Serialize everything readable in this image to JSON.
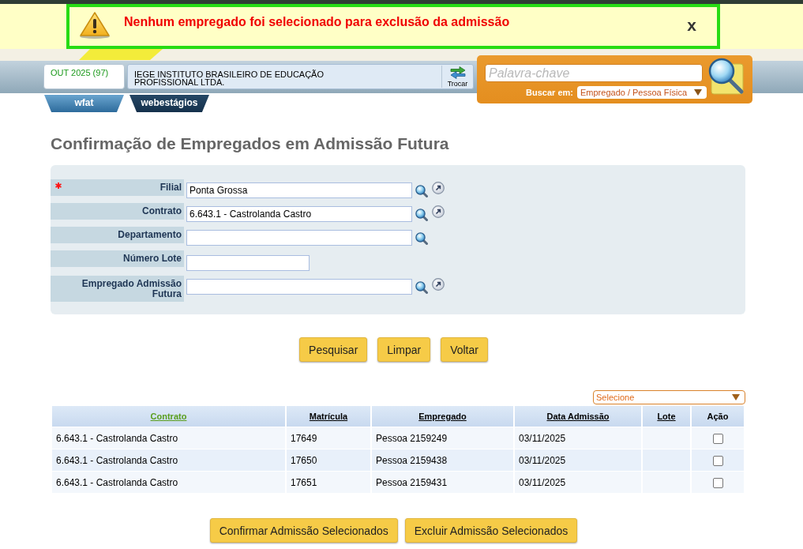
{
  "alert": {
    "message": "Nenhum empregado foi selecionado para exclusão da admissão",
    "close": "x"
  },
  "header": {
    "period": "OUT 2025 (97)",
    "company": "IEGE INSTITUTO BRASILEIRO DE EDUCAÇÃO PROFISSIONAL LTDA.",
    "switch_button": "Trocar",
    "tabs": [
      {
        "label": "wfat",
        "selected": false
      },
      {
        "label": "webestágios",
        "selected": true
      }
    ],
    "search": {
      "placeholder": "Palavra-chave",
      "scope_label": "Buscar em:",
      "scope_value": "Empregado / Pessoa Física"
    }
  },
  "page_title": "Confirmação de Empregados em Admissão Futura",
  "form": {
    "fields": [
      {
        "label": "Filial",
        "value": "Ponta Grossa",
        "required": true,
        "kind": "wide",
        "lookup": true,
        "open": true
      },
      {
        "label": "Contrato",
        "value": "6.643.1 - Castrolanda Castro",
        "required": false,
        "kind": "wide",
        "lookup": true,
        "open": true
      },
      {
        "label": "Departamento",
        "required": false,
        "kind": "wide",
        "lookup": true,
        "open": false
      },
      {
        "label": "Número Lote",
        "required": false,
        "kind": "narrow",
        "lookup": false,
        "open": false
      },
      {
        "label": "Empregado Admissão Futura",
        "required": false,
        "kind": "wide",
        "lookup": true,
        "open": true
      }
    ],
    "buttons": [
      "Pesquisar",
      "Limpar",
      "Voltar"
    ]
  },
  "table": {
    "action_select": "Selecione",
    "columns": [
      {
        "label": "Contrato",
        "kind": "sortable",
        "selected": true
      },
      {
        "label": "Matrícula",
        "kind": "sortable",
        "selected": false
      },
      {
        "label": "Empregado",
        "kind": "sortable",
        "selected": false
      },
      {
        "label": "Data Admissão",
        "kind": "sortable",
        "selected": false
      },
      {
        "label": "Lote",
        "kind": "sortable",
        "selected": false
      },
      {
        "label": "Ação",
        "kind": "plain",
        "selected": false
      }
    ],
    "rows": [
      {
        "contrato": "6.643.1 - Castrolanda Castro",
        "matricula": "17649",
        "empregado": "Pessoa 2159249",
        "data_admissao": "03/11/2025",
        "checked": false
      },
      {
        "contrato": "6.643.1 - Castrolanda Castro",
        "matricula": "17650",
        "empregado": "Pessoa 2159438",
        "data_admissao": "03/11/2025",
        "checked": false
      },
      {
        "contrato": "6.643.1 - Castrolanda Castro",
        "matricula": "17651",
        "empregado": "Pessoa 2159431",
        "data_admissao": "03/11/2025",
        "checked": false
      }
    ]
  },
  "bottom_buttons": [
    "Confirmar Admissão Selecionados",
    "Excluir Admissão Selecionados"
  ]
}
